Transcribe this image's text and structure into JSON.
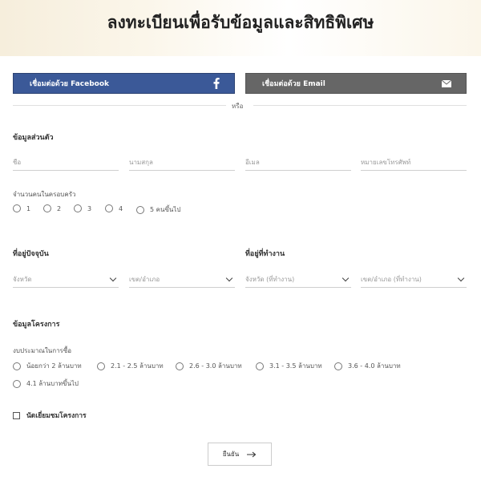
{
  "header": {
    "title": "ลงทะเบียนเพื่อรับข้อมูลและสิทธิพิเศษ"
  },
  "social": {
    "facebook_label": "เชื่อมต่อด้วย Facebook",
    "email_label": "เชื่อมต่อด้วย Email",
    "facebook_color": "#3b5998",
    "email_color": "#666666",
    "or_text": "หรือ"
  },
  "personal": {
    "title": "ข้อมูลส่วนตัว",
    "fields": [
      {
        "placeholder": "ชื่อ"
      },
      {
        "placeholder": "นามสกุล"
      },
      {
        "placeholder": "อีเมล"
      },
      {
        "placeholder": "หมายเลขโทรศัพท์"
      }
    ],
    "household_label": "จำนวนคนในครอบครัว",
    "household_options": [
      "1",
      "2",
      "3",
      "4",
      "5 คนขึ้นไป"
    ]
  },
  "address": {
    "home_title": "ที่อยู่ปัจจุบัน",
    "work_title": "ที่อยู่ที่ทำงาน",
    "home_province": "จังหวัด",
    "home_district": "เขต/อำเภอ",
    "work_province": "จังหวัด (ที่ทำงาน)",
    "work_district": "เขต/อำเภอ (ที่ทำงาน)"
  },
  "project": {
    "title": "ข้อมูลโครงการ",
    "budget_label": "งบประมาณในการซื้อ",
    "budget_options": [
      "น้อยกว่า 2 ล้านบาท",
      "2.1 - 2.5 ล้านบาท",
      "2.6 - 3.0 ล้านบาท",
      "3.1 - 3.5 ล้านบาท",
      "3.6 - 4.0 ล้านบาท",
      "4.1 ล้านบาทขึ้นไป"
    ],
    "visit_label": "นัดเยี่ยมชมโครงการ"
  },
  "submit": {
    "label": "ยืนยัน"
  }
}
